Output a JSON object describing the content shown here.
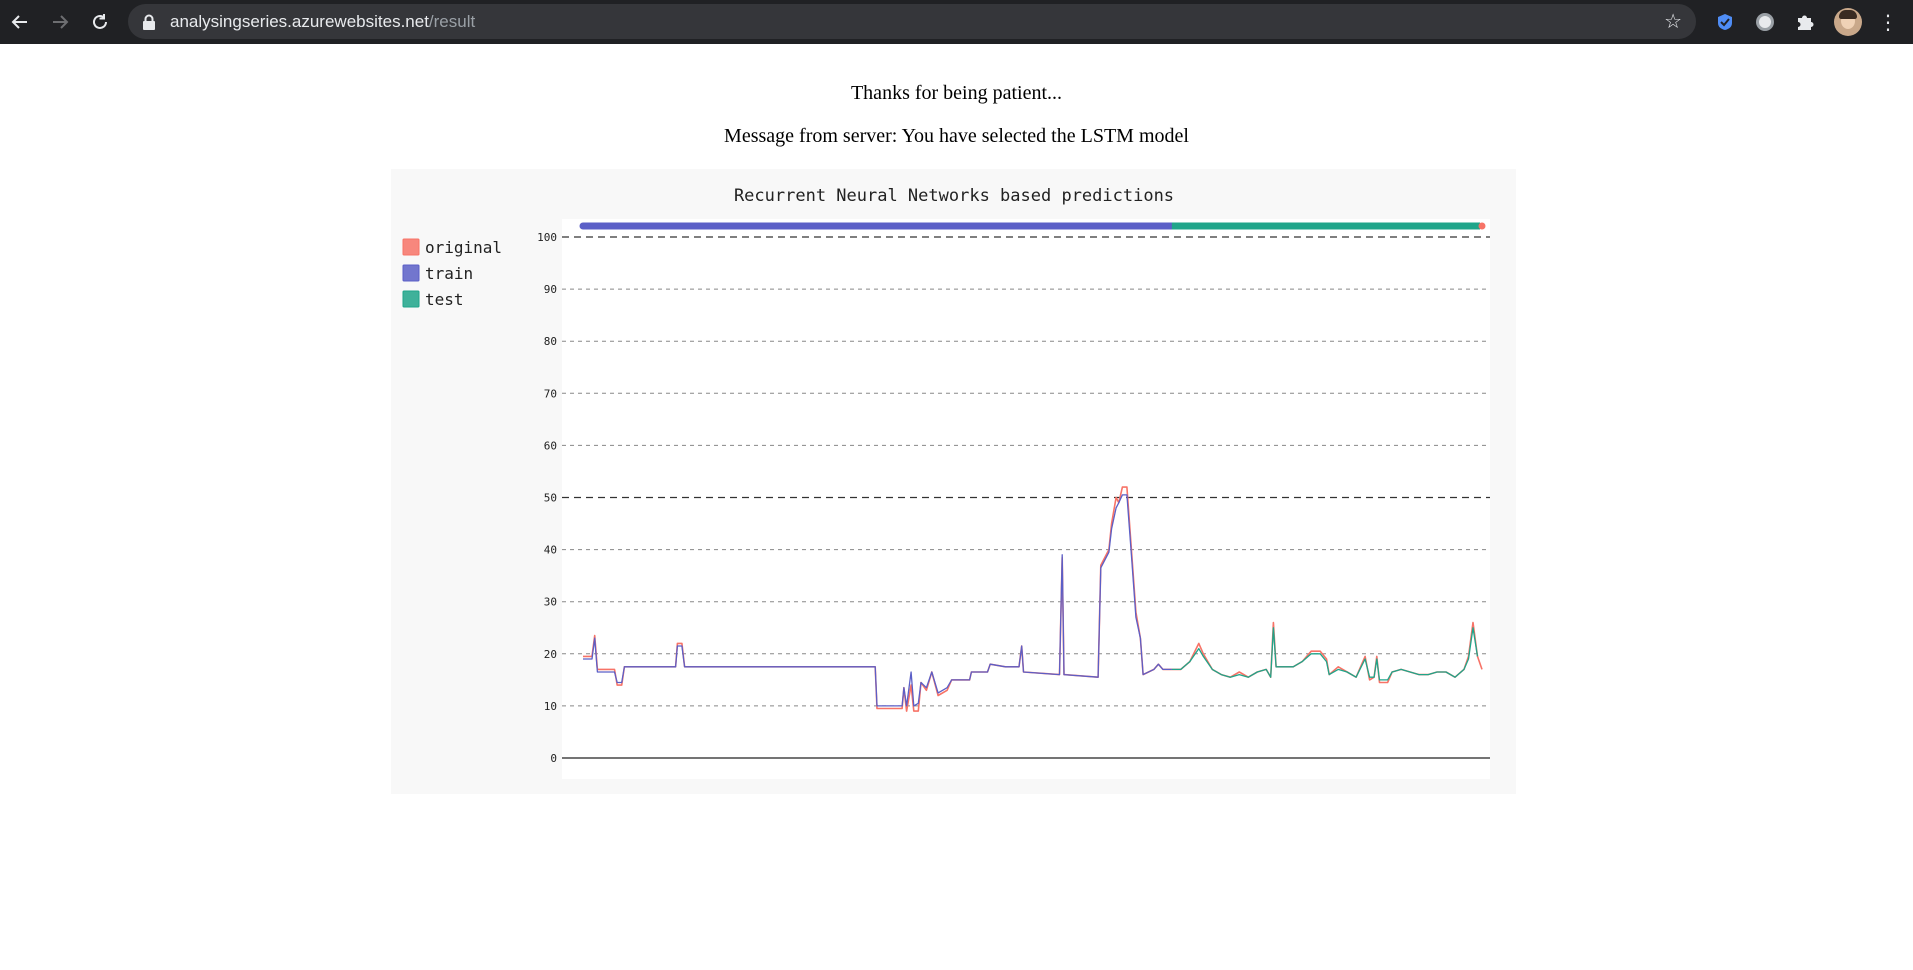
{
  "browser": {
    "url_host": "analysingseries.azurewebsites.net",
    "url_path": "/result",
    "icons": [
      "back-arrow-icon",
      "forward-arrow-icon",
      "reload-icon",
      "lock-icon",
      "star-icon",
      "extension-icon",
      "puzzle-icon",
      "kebab-menu-icon"
    ]
  },
  "page": {
    "line1": "Thanks for being patient...",
    "line2": "Message from server: You have selected the LSTM model"
  },
  "colors": {
    "original": "#f77367",
    "train": "#5b5fc7",
    "test": "#1fa58a",
    "browser_bar": "#202124",
    "panel": "#f8f8f8"
  },
  "chart_data": {
    "type": "line",
    "title": "Recurrent Neural Networks based predictions",
    "legend_position": "top-left",
    "legend": [
      "original",
      "train",
      "test"
    ],
    "ylim": [
      0,
      100
    ],
    "ytick_labels": [
      "0",
      "10",
      "20",
      "30",
      "40",
      "50",
      "60",
      "70",
      "80",
      "90",
      "100"
    ],
    "grid": true,
    "x_range": [
      0,
      100
    ],
    "train_end_x": 65.5,
    "series": [
      {
        "name": "original",
        "color": "#f77367",
        "points": [
          [
            0,
            19.5
          ],
          [
            1,
            19.5
          ],
          [
            1.3,
            23.5
          ],
          [
            1.6,
            17
          ],
          [
            3.5,
            17
          ],
          [
            3.8,
            14
          ],
          [
            4.3,
            14
          ],
          [
            4.6,
            17.5
          ],
          [
            10.3,
            17.5
          ],
          [
            10.5,
            22
          ],
          [
            11,
            22
          ],
          [
            11.3,
            17.5
          ],
          [
            32.5,
            17.5
          ],
          [
            32.7,
            9.5
          ],
          [
            35.5,
            9.5
          ],
          [
            35.7,
            13.5
          ],
          [
            36,
            9
          ],
          [
            36.5,
            14
          ],
          [
            36.8,
            9
          ],
          [
            37.3,
            9
          ],
          [
            37.6,
            14.5
          ],
          [
            38.2,
            13
          ],
          [
            38.8,
            16.5
          ],
          [
            39.5,
            12
          ],
          [
            40.5,
            13
          ],
          [
            41,
            15
          ],
          [
            43,
            15
          ],
          [
            43.2,
            16.5
          ],
          [
            45,
            16.5
          ],
          [
            45.3,
            18
          ],
          [
            47,
            17.5
          ],
          [
            48.5,
            17.5
          ],
          [
            48.8,
            21.5
          ],
          [
            49,
            16.5
          ],
          [
            53,
            16
          ],
          [
            53.3,
            38.5
          ],
          [
            53.5,
            16
          ],
          [
            57.3,
            15.5
          ],
          [
            57.6,
            37
          ],
          [
            58.5,
            40
          ],
          [
            58.8,
            45
          ],
          [
            59.3,
            50
          ],
          [
            59.6,
            49
          ],
          [
            60,
            52
          ],
          [
            60.5,
            52
          ],
          [
            61,
            40
          ],
          [
            61.5,
            28
          ],
          [
            62,
            23
          ],
          [
            62.3,
            16
          ],
          [
            63.5,
            17
          ],
          [
            64,
            18
          ],
          [
            64.5,
            17
          ],
          [
            65.5,
            17
          ],
          [
            66.5,
            17
          ],
          [
            67.5,
            18.5
          ],
          [
            68.5,
            22
          ],
          [
            69,
            20
          ],
          [
            70,
            17
          ],
          [
            71,
            16
          ],
          [
            72,
            15.5
          ],
          [
            73,
            16.5
          ],
          [
            74,
            15.5
          ],
          [
            75,
            16.5
          ],
          [
            76,
            17
          ],
          [
            76.5,
            15.5
          ],
          [
            76.8,
            26
          ],
          [
            77.1,
            17.5
          ],
          [
            79,
            17.5
          ],
          [
            80,
            18.5
          ],
          [
            81,
            20.5
          ],
          [
            82,
            20.5
          ],
          [
            82.7,
            19
          ],
          [
            83,
            16
          ],
          [
            84,
            17.5
          ],
          [
            85,
            16.5
          ],
          [
            86,
            15.5
          ],
          [
            87,
            19.5
          ],
          [
            87.5,
            15
          ],
          [
            88,
            15.5
          ],
          [
            88.3,
            19.5
          ],
          [
            88.6,
            14.5
          ],
          [
            89.5,
            14.5
          ],
          [
            90,
            16.5
          ],
          [
            91,
            17
          ],
          [
            92,
            16.5
          ],
          [
            93,
            16
          ],
          [
            94,
            16
          ],
          [
            95,
            16.5
          ],
          [
            96,
            16.5
          ],
          [
            97,
            15.5
          ],
          [
            98,
            17
          ],
          [
            98.5,
            19.5
          ],
          [
            99,
            26
          ],
          [
            99.5,
            19.5
          ],
          [
            100,
            17
          ]
        ]
      },
      {
        "name": "train",
        "color": "#5b5fc7",
        "points": [
          [
            0,
            19
          ],
          [
            1,
            19
          ],
          [
            1.3,
            23
          ],
          [
            1.6,
            16.5
          ],
          [
            3.5,
            16.5
          ],
          [
            3.8,
            14.5
          ],
          [
            4.3,
            14.5
          ],
          [
            4.6,
            17.5
          ],
          [
            10.3,
            17.5
          ],
          [
            10.5,
            21.5
          ],
          [
            11,
            21.5
          ],
          [
            11.3,
            17.5
          ],
          [
            32.5,
            17.5
          ],
          [
            32.7,
            10
          ],
          [
            35.5,
            10
          ],
          [
            35.7,
            13.5
          ],
          [
            36,
            10
          ],
          [
            36.5,
            16.5
          ],
          [
            36.8,
            10
          ],
          [
            37.3,
            10.5
          ],
          [
            37.6,
            14.5
          ],
          [
            38.2,
            13.5
          ],
          [
            38.8,
            16.5
          ],
          [
            39.5,
            12.5
          ],
          [
            40.5,
            13.5
          ],
          [
            41,
            15
          ],
          [
            43,
            15
          ],
          [
            43.2,
            16.5
          ],
          [
            45,
            16.5
          ],
          [
            45.3,
            18
          ],
          [
            47,
            17.5
          ],
          [
            48.5,
            17.5
          ],
          [
            48.8,
            21.5
          ],
          [
            49,
            16.5
          ],
          [
            53,
            16
          ],
          [
            53.3,
            39
          ],
          [
            53.5,
            16
          ],
          [
            57.3,
            15.5
          ],
          [
            57.6,
            36.5
          ],
          [
            58.5,
            39.5
          ],
          [
            58.8,
            44
          ],
          [
            59.3,
            48
          ],
          [
            59.6,
            49
          ],
          [
            60,
            50.5
          ],
          [
            60.5,
            50.5
          ],
          [
            61,
            39
          ],
          [
            61.5,
            27
          ],
          [
            62,
            23
          ],
          [
            62.3,
            16
          ],
          [
            63.5,
            17
          ],
          [
            64,
            18
          ],
          [
            64.5,
            17
          ],
          [
            65.5,
            17
          ]
        ]
      },
      {
        "name": "test",
        "color": "#1fa58a",
        "points": [
          [
            65.5,
            17
          ],
          [
            66.5,
            17
          ],
          [
            67.5,
            18.5
          ],
          [
            68.5,
            21
          ],
          [
            69,
            19.5
          ],
          [
            70,
            17
          ],
          [
            71,
            16
          ],
          [
            72,
            15.5
          ],
          [
            73,
            16
          ],
          [
            74,
            15.5
          ],
          [
            75,
            16.5
          ],
          [
            76,
            17
          ],
          [
            76.5,
            15.5
          ],
          [
            76.8,
            25
          ],
          [
            77.1,
            17.5
          ],
          [
            79,
            17.5
          ],
          [
            80,
            18.5
          ],
          [
            81,
            20
          ],
          [
            82,
            20
          ],
          [
            82.7,
            18.5
          ],
          [
            83,
            16
          ],
          [
            84,
            17
          ],
          [
            85,
            16.5
          ],
          [
            86,
            15.5
          ],
          [
            87,
            19
          ],
          [
            87.5,
            15.5
          ],
          [
            88,
            15.5
          ],
          [
            88.3,
            19
          ],
          [
            88.6,
            15
          ],
          [
            89.5,
            15
          ],
          [
            90,
            16.5
          ],
          [
            91,
            17
          ],
          [
            92,
            16.5
          ],
          [
            93,
            16
          ],
          [
            94,
            16
          ],
          [
            95,
            16.5
          ],
          [
            96,
            16.5
          ],
          [
            97,
            15.5
          ],
          [
            98,
            17
          ],
          [
            98.5,
            19
          ],
          [
            99,
            25
          ],
          [
            99.5,
            19.5
          ]
        ]
      }
    ]
  }
}
